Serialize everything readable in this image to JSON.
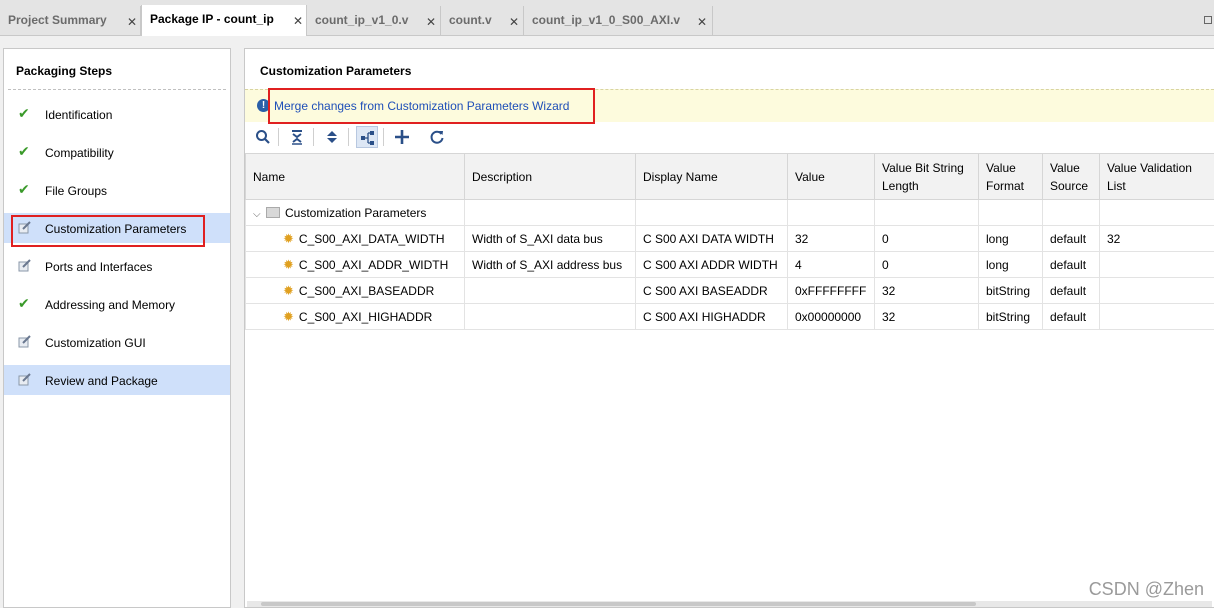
{
  "tabs": [
    {
      "label": "Project Summary"
    },
    {
      "label": "Package IP - count_ip"
    },
    {
      "label": "count_ip_v1_0.v"
    },
    {
      "label": "count.v"
    },
    {
      "label": "count_ip_v1_0_S00_AXI.v"
    }
  ],
  "sidebar": {
    "title": "Packaging Steps",
    "steps": [
      {
        "label": "Identification",
        "status": "check-icon"
      },
      {
        "label": "Compatibility",
        "status": "check-icon"
      },
      {
        "label": "File Groups",
        "status": "check-icon"
      },
      {
        "label": "Customization Parameters",
        "status": "edit-icon"
      },
      {
        "label": "Ports and Interfaces",
        "status": "edit-icon"
      },
      {
        "label": "Addressing and Memory",
        "status": "check-icon"
      },
      {
        "label": "Customization GUI",
        "status": "edit-icon"
      },
      {
        "label": "Review and Package",
        "status": "edit-icon"
      }
    ]
  },
  "main": {
    "title": "Customization Parameters",
    "info_link": "Merge changes from Customization Parameters Wizard",
    "toolbar_icons": [
      "search-icon",
      "collapse-all-icon",
      "expand-all-icon",
      "hierarchy-icon",
      "add-icon",
      "refresh-icon"
    ],
    "table": {
      "headers": [
        "Name",
        "Description",
        "Display Name",
        "Value",
        "Value Bit String Length",
        "Value Format",
        "Value Source",
        "Value Validation List"
      ],
      "group": "Customization Parameters",
      "rows": [
        [
          "C_S00_AXI_DATA_WIDTH",
          "Width of S_AXI data bus",
          "C S00 AXI DATA WIDTH",
          "32",
          "0",
          "long",
          "default",
          "32"
        ],
        [
          "C_S00_AXI_ADDR_WIDTH",
          "Width of S_AXI address bus",
          "C S00 AXI ADDR WIDTH",
          "4",
          "0",
          "long",
          "default",
          ""
        ],
        [
          "C_S00_AXI_BASEADDR",
          "",
          "C S00 AXI BASEADDR",
          "0xFFFFFFFF",
          "32",
          "bitString",
          "default",
          ""
        ],
        [
          "C_S00_AXI_HIGHADDR",
          "",
          "C S00 AXI HIGHADDR",
          "0x00000000",
          "32",
          "bitString",
          "default",
          ""
        ]
      ]
    }
  },
  "watermark": "CSDN @Zhen ",
  "colors": {
    "accent": "#1f4fb8",
    "selected": "#cfe0fa",
    "highlight_box": "#e02020",
    "check": "#3a9a2a",
    "info_bg": "#fdfbdd"
  }
}
